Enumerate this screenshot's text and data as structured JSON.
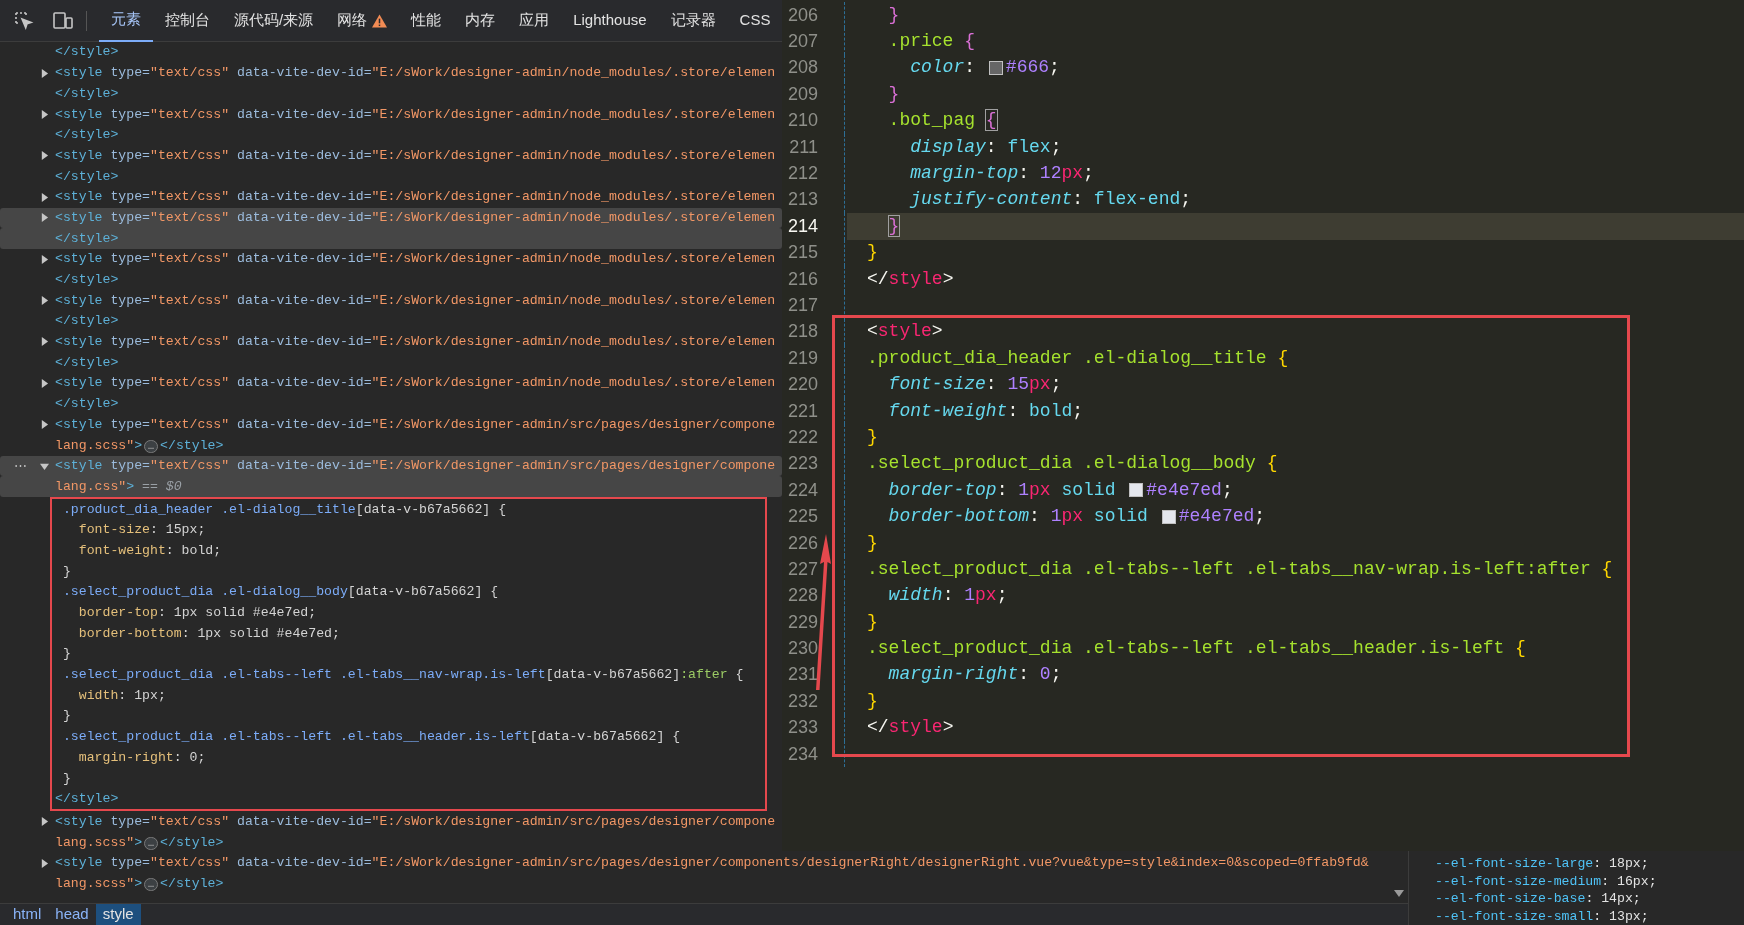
{
  "devtools": {
    "tabs": [
      {
        "label": "元素",
        "selected": true
      },
      {
        "label": "控制台",
        "selected": false
      },
      {
        "label": "源代码/来源",
        "selected": false
      },
      {
        "label": "网络",
        "selected": false,
        "warning": true
      },
      {
        "label": "性能",
        "selected": false
      },
      {
        "label": "内存",
        "selected": false
      },
      {
        "label": "应用",
        "selected": false
      },
      {
        "label": "Lighthouse",
        "selected": false
      },
      {
        "label": "记录器",
        "selected": false
      },
      {
        "label": "CSS",
        "selected": false
      }
    ],
    "rows": [
      {
        "kind": "node",
        "highlighted": false,
        "tokens": [
          {
            "kind": "tag",
            "text": "</style>"
          }
        ]
      },
      {
        "kind": "node",
        "highlighted": false,
        "expanded": false,
        "tokens": [
          {
            "kind": "tag",
            "text": "<style"
          },
          {
            "kind": "attr",
            "text": " type="
          },
          {
            "kind": "val",
            "text": "\"text/css\""
          },
          {
            "kind": "attr",
            "text": " data-vite-dev-id="
          },
          {
            "kind": "val",
            "text": "\"E:/sWork/designer-admin/node_modules/.store/elemen"
          }
        ]
      },
      {
        "kind": "node",
        "highlighted": false,
        "tokens": [
          {
            "kind": "tag",
            "text": "</style>"
          }
        ]
      },
      {
        "kind": "node",
        "highlighted": false,
        "expanded": false,
        "tokens": [
          {
            "kind": "tag",
            "text": "<style"
          },
          {
            "kind": "attr",
            "text": " type="
          },
          {
            "kind": "val",
            "text": "\"text/css\""
          },
          {
            "kind": "attr",
            "text": " data-vite-dev-id="
          },
          {
            "kind": "val",
            "text": "\"E:/sWork/designer-admin/node_modules/.store/elemen"
          }
        ]
      },
      {
        "kind": "node",
        "highlighted": false,
        "tokens": [
          {
            "kind": "tag",
            "text": "</style>"
          }
        ]
      },
      {
        "kind": "node",
        "highlighted": false,
        "expanded": false,
        "tokens": [
          {
            "kind": "tag",
            "text": "<style"
          },
          {
            "kind": "attr",
            "text": " type="
          },
          {
            "kind": "val",
            "text": "\"text/css\""
          },
          {
            "kind": "attr",
            "text": " data-vite-dev-id="
          },
          {
            "kind": "val",
            "text": "\"E:/sWork/designer-admin/node_modules/.store/elemen"
          }
        ]
      },
      {
        "kind": "node",
        "highlighted": false,
        "tokens": [
          {
            "kind": "tag",
            "text": "</style>"
          }
        ]
      },
      {
        "kind": "node",
        "highlighted": false,
        "expanded": false,
        "tokens": [
          {
            "kind": "tag",
            "text": "<style"
          },
          {
            "kind": "attr",
            "text": " type="
          },
          {
            "kind": "val",
            "text": "\"text/css\""
          },
          {
            "kind": "attr",
            "text": " data-vite-dev-id="
          },
          {
            "kind": "val",
            "text": "\"E:/sWork/designer-admin/node_modules/.store/elemen"
          }
        ]
      },
      {
        "kind": "node",
        "highlighted": true,
        "expanded": false,
        "tokens": [
          {
            "kind": "tag",
            "text": "<style"
          },
          {
            "kind": "attr",
            "text": " type="
          },
          {
            "kind": "val",
            "text": "\"text/css\""
          },
          {
            "kind": "attr",
            "text": " data-vite-dev-id="
          },
          {
            "kind": "val",
            "text": "\"E:/sWork/designer-admin/node_modules/.store/elemen"
          }
        ]
      },
      {
        "kind": "node",
        "highlighted": true,
        "tokens": [
          {
            "kind": "tag",
            "text": "</style>"
          }
        ]
      },
      {
        "kind": "node",
        "highlighted": false,
        "expanded": false,
        "tokens": [
          {
            "kind": "tag",
            "text": "<style"
          },
          {
            "kind": "attr",
            "text": " type="
          },
          {
            "kind": "val",
            "text": "\"text/css\""
          },
          {
            "kind": "attr",
            "text": " data-vite-dev-id="
          },
          {
            "kind": "val",
            "text": "\"E:/sWork/designer-admin/node_modules/.store/elemen"
          }
        ]
      },
      {
        "kind": "node",
        "highlighted": false,
        "tokens": [
          {
            "kind": "tag",
            "text": "</style>"
          }
        ]
      },
      {
        "kind": "node",
        "highlighted": false,
        "expanded": false,
        "tokens": [
          {
            "kind": "tag",
            "text": "<style"
          },
          {
            "kind": "attr",
            "text": " type="
          },
          {
            "kind": "val",
            "text": "\"text/css\""
          },
          {
            "kind": "attr",
            "text": " data-vite-dev-id="
          },
          {
            "kind": "val",
            "text": "\"E:/sWork/designer-admin/node_modules/.store/elemen"
          }
        ]
      },
      {
        "kind": "node",
        "highlighted": false,
        "tokens": [
          {
            "kind": "tag",
            "text": "</style>"
          }
        ]
      },
      {
        "kind": "node",
        "highlighted": false,
        "expanded": false,
        "tokens": [
          {
            "kind": "tag",
            "text": "<style"
          },
          {
            "kind": "attr",
            "text": " type="
          },
          {
            "kind": "val",
            "text": "\"text/css\""
          },
          {
            "kind": "attr",
            "text": " data-vite-dev-id="
          },
          {
            "kind": "val",
            "text": "\"E:/sWork/designer-admin/node_modules/.store/elemen"
          }
        ]
      },
      {
        "kind": "node",
        "highlighted": false,
        "tokens": [
          {
            "kind": "tag",
            "text": "</style>"
          }
        ]
      },
      {
        "kind": "node",
        "highlighted": false,
        "expanded": false,
        "tokens": [
          {
            "kind": "tag",
            "text": "<style"
          },
          {
            "kind": "attr",
            "text": " type="
          },
          {
            "kind": "val",
            "text": "\"text/css\""
          },
          {
            "kind": "attr",
            "text": " data-vite-dev-id="
          },
          {
            "kind": "val",
            "text": "\"E:/sWork/designer-admin/node_modules/.store/elemen"
          }
        ]
      },
      {
        "kind": "node",
        "highlighted": false,
        "tokens": [
          {
            "kind": "tag",
            "text": "</style>"
          }
        ]
      },
      {
        "kind": "node",
        "highlighted": false,
        "expanded": false,
        "tokens": [
          {
            "kind": "tag",
            "text": "<style"
          },
          {
            "kind": "attr",
            "text": " type="
          },
          {
            "kind": "val",
            "text": "\"text/css\""
          },
          {
            "kind": "attr",
            "text": " data-vite-dev-id="
          },
          {
            "kind": "val",
            "text": "\"E:/sWork/designer-admin/src/pages/designer/compone"
          }
        ]
      },
      {
        "kind": "node",
        "highlighted": false,
        "tokens": [
          {
            "kind": "val",
            "text": "lang.scss\""
          },
          {
            "kind": "tag",
            "text": ">"
          },
          {
            "kind": "badge",
            "text": "…"
          },
          {
            "kind": "tag",
            "text": "</style>"
          }
        ]
      },
      {
        "kind": "node",
        "highlighted": true,
        "expanded": true,
        "marker": "⋯",
        "tokens": [
          {
            "kind": "tag",
            "text": "<style"
          },
          {
            "kind": "attr",
            "text": " type="
          },
          {
            "kind": "val",
            "text": "\"text/css\""
          },
          {
            "kind": "attr",
            "text": " data-vite-dev-id="
          },
          {
            "kind": "val",
            "text": "\"E:/sWork/designer-admin/src/pages/designer/compone"
          }
        ]
      },
      {
        "kind": "node",
        "highlighted": true,
        "tokens": [
          {
            "kind": "val",
            "text": "lang.css\""
          },
          {
            "kind": "tag",
            "text": ">"
          },
          {
            "kind": "note",
            "text": " == $0"
          }
        ]
      },
      {
        "kind": "annotation_frame",
        "rows": [
          {
            "tokens": [
              {
                "kind": "sel",
                "text": " .product_dia_header .el-dialog__title"
              },
              {
                "kind": "plain",
                "text": "[data-v-b67a5662] {"
              }
            ]
          },
          {
            "tokens": [
              {
                "kind": "prop",
                "text": "   font-size"
              },
              {
                "kind": "plain",
                "text": ": 15px;"
              }
            ]
          },
          {
            "tokens": [
              {
                "kind": "prop",
                "text": "   font-weight"
              },
              {
                "kind": "plain",
                "text": ": bold;"
              }
            ]
          },
          {
            "tokens": [
              {
                "kind": "plain",
                "text": " }"
              }
            ]
          },
          {
            "tokens": [
              {
                "kind": "sel",
                "text": " .select_product_dia .el-dialog__body"
              },
              {
                "kind": "plain",
                "text": "[data-v-b67a5662] {"
              }
            ]
          },
          {
            "tokens": [
              {
                "kind": "prop",
                "text": "   border-top"
              },
              {
                "kind": "plain",
                "text": ": 1px solid #e4e7ed;"
              }
            ]
          },
          {
            "tokens": [
              {
                "kind": "prop",
                "text": "   border-bottom"
              },
              {
                "kind": "plain",
                "text": ": 1px solid #e4e7ed;"
              }
            ]
          },
          {
            "tokens": [
              {
                "kind": "plain",
                "text": " }"
              }
            ]
          },
          {
            "tokens": [
              {
                "kind": "sel",
                "text": " .select_product_dia .el-tabs--left .el-tabs__nav-wrap.is-left"
              },
              {
                "kind": "plain",
                "text": "[data-v-b67a5662]"
              },
              {
                "kind": "pseudo",
                "text": ":after"
              },
              {
                "kind": "plain",
                "text": " {"
              }
            ]
          },
          {
            "tokens": [
              {
                "kind": "prop",
                "text": "   width"
              },
              {
                "kind": "plain",
                "text": ": 1px;"
              }
            ]
          },
          {
            "tokens": [
              {
                "kind": "plain",
                "text": " }"
              }
            ]
          },
          {
            "tokens": [
              {
                "kind": "sel",
                "text": " .select_product_dia .el-tabs--left .el-tabs__header.is-left"
              },
              {
                "kind": "plain",
                "text": "[data-v-b67a5662] {"
              }
            ]
          },
          {
            "tokens": [
              {
                "kind": "prop",
                "text": "   margin-right"
              },
              {
                "kind": "plain",
                "text": ": 0;"
              }
            ]
          },
          {
            "tokens": [
              {
                "kind": "plain",
                "text": " }"
              }
            ]
          },
          {
            "tokens": [
              {
                "kind": "tag",
                "text": "</style>"
              }
            ]
          }
        ]
      },
      {
        "kind": "node",
        "highlighted": false,
        "expanded": false,
        "tokens": [
          {
            "kind": "tag",
            "text": "<style"
          },
          {
            "kind": "attr",
            "text": " type="
          },
          {
            "kind": "val",
            "text": "\"text/css\""
          },
          {
            "kind": "attr",
            "text": " data-vite-dev-id="
          },
          {
            "kind": "val",
            "text": "\"E:/sWork/designer-admin/src/pages/designer/compone"
          }
        ]
      },
      {
        "kind": "node",
        "highlighted": false,
        "tokens": [
          {
            "kind": "val",
            "text": "lang.scss\""
          },
          {
            "kind": "tag",
            "text": ">"
          },
          {
            "kind": "badge",
            "text": "…"
          },
          {
            "kind": "tag",
            "text": "</style>"
          }
        ]
      },
      {
        "kind": "node",
        "highlighted": false,
        "expanded": false,
        "tokens": [
          {
            "kind": "tag",
            "text": "<style"
          },
          {
            "kind": "attr",
            "text": " type="
          },
          {
            "kind": "val",
            "text": "\"text/css\""
          },
          {
            "kind": "attr",
            "text": " data-vite-dev-id="
          },
          {
            "kind": "val",
            "text": "\"E:/sWork/designer-admin/src/pages/designer/components/designerRight/designerRight.vue?vue&type=style&index=0&scoped=0ffab9fd&"
          }
        ]
      },
      {
        "kind": "node",
        "highlighted": false,
        "tokens": [
          {
            "kind": "val",
            "text": "lang.scss\""
          },
          {
            "kind": "tag",
            "text": ">"
          },
          {
            "kind": "badge",
            "text": "…"
          },
          {
            "kind": "tag",
            "text": "</style>"
          }
        ]
      }
    ],
    "breadcrumbs": [
      {
        "label": "html",
        "selected": false
      },
      {
        "label": "head",
        "selected": false
      },
      {
        "label": "style",
        "selected": true
      }
    ],
    "styles": [
      {
        "prop": "--el-font-size-large",
        "value": ": 18px;"
      },
      {
        "prop": "--el-font-size-medium",
        "value": ": 16px;"
      },
      {
        "prop": "--el-font-size-base",
        "value": ": 14px;"
      },
      {
        "prop": "--el-font-size-small",
        "value": ": 13px;"
      }
    ]
  },
  "editor": {
    "lines": [
      {
        "number": "206",
        "current": false,
        "tokens": [
          {
            "kind": "bi",
            "text": "  }"
          }
        ]
      },
      {
        "number": "207",
        "current": false,
        "tokens": [
          {
            "kind": "sel",
            "text": "  .price "
          },
          {
            "kind": "bi",
            "text": "{"
          }
        ]
      },
      {
        "number": "208",
        "current": false,
        "tokens": [
          {
            "kind": "prop",
            "text": "    color"
          },
          {
            "kind": "p",
            "text": ": "
          },
          {
            "kind": "sw",
            "color": "#666666"
          },
          {
            "kind": "hex",
            "text": "#666"
          },
          {
            "kind": "p",
            "text": ";"
          }
        ]
      },
      {
        "number": "209",
        "current": false,
        "tokens": [
          {
            "kind": "bi",
            "text": "  }"
          }
        ]
      },
      {
        "number": "210",
        "current": false,
        "tokens": [
          {
            "kind": "sel",
            "text": "  .bot_pag "
          },
          {
            "kind": "bi",
            "text": "{",
            "matched": true
          }
        ]
      },
      {
        "number": "211",
        "current": false,
        "tokens": [
          {
            "kind": "prop",
            "text": "    display"
          },
          {
            "kind": "p",
            "text": ": "
          },
          {
            "kind": "v",
            "text": "flex"
          },
          {
            "kind": "p",
            "text": ";"
          }
        ]
      },
      {
        "number": "212",
        "current": false,
        "tokens": [
          {
            "kind": "prop",
            "text": "    margin-top"
          },
          {
            "kind": "p",
            "text": ": "
          },
          {
            "kind": "n",
            "text": "12"
          },
          {
            "kind": "u",
            "text": "px"
          },
          {
            "kind": "p",
            "text": ";"
          }
        ]
      },
      {
        "number": "213",
        "current": false,
        "tokens": [
          {
            "kind": "prop",
            "text": "    justify-content"
          },
          {
            "kind": "p",
            "text": ": "
          },
          {
            "kind": "v",
            "text": "flex-end"
          },
          {
            "kind": "p",
            "text": ";"
          }
        ]
      },
      {
        "number": "214",
        "current": true,
        "tokens": [
          {
            "kind": "bi",
            "text": "  }",
            "matched": true
          }
        ]
      },
      {
        "number": "215",
        "current": false,
        "tokens": [
          {
            "kind": "bo",
            "text": "}"
          }
        ]
      },
      {
        "number": "216",
        "current": false,
        "tokens": [
          {
            "kind": "p",
            "text": "</"
          },
          {
            "kind": "tag",
            "text": "style"
          },
          {
            "kind": "p",
            "text": ">"
          }
        ]
      },
      {
        "number": "217",
        "current": false
      },
      {
        "number": "218",
        "current": false,
        "tokens": [
          {
            "kind": "p",
            "text": "<"
          },
          {
            "kind": "tag",
            "text": "style"
          },
          {
            "kind": "p",
            "text": ">"
          }
        ]
      },
      {
        "number": "219",
        "current": false,
        "tokens": [
          {
            "kind": "sel",
            "text": ".product_dia_header .el-dialog__title "
          },
          {
            "kind": "bo",
            "text": "{"
          }
        ]
      },
      {
        "number": "220",
        "current": false,
        "tokens": [
          {
            "kind": "prop",
            "text": "  font-size"
          },
          {
            "kind": "p",
            "text": ": "
          },
          {
            "kind": "n",
            "text": "15"
          },
          {
            "kind": "u",
            "text": "px"
          },
          {
            "kind": "p",
            "text": ";"
          }
        ]
      },
      {
        "number": "221",
        "current": false,
        "tokens": [
          {
            "kind": "prop",
            "text": "  font-weight"
          },
          {
            "kind": "p",
            "text": ": "
          },
          {
            "kind": "v",
            "text": "bold"
          },
          {
            "kind": "p",
            "text": ";"
          }
        ]
      },
      {
        "number": "222",
        "current": false,
        "tokens": [
          {
            "kind": "bo",
            "text": "}"
          }
        ]
      },
      {
        "number": "223",
        "current": false,
        "tokens": [
          {
            "kind": "sel",
            "text": ".select_product_dia .el-dialog__body "
          },
          {
            "kind": "bo",
            "text": "{"
          }
        ]
      },
      {
        "number": "224",
        "current": false,
        "tokens": [
          {
            "kind": "prop",
            "text": "  border-top"
          },
          {
            "kind": "p",
            "text": ": "
          },
          {
            "kind": "n",
            "text": "1"
          },
          {
            "kind": "u",
            "text": "px"
          },
          {
            "kind": "v",
            "text": " solid "
          },
          {
            "kind": "sw",
            "color": "#e4e7ed"
          },
          {
            "kind": "hex",
            "text": "#e4e7ed"
          },
          {
            "kind": "p",
            "text": ";"
          }
        ]
      },
      {
        "number": "225",
        "current": false,
        "tokens": [
          {
            "kind": "prop",
            "text": "  border-bottom"
          },
          {
            "kind": "p",
            "text": ": "
          },
          {
            "kind": "n",
            "text": "1"
          },
          {
            "kind": "u",
            "text": "px"
          },
          {
            "kind": "v",
            "text": " solid "
          },
          {
            "kind": "sw",
            "color": "#e4e7ed"
          },
          {
            "kind": "hex",
            "text": "#e4e7ed"
          },
          {
            "kind": "p",
            "text": ";"
          }
        ]
      },
      {
        "number": "226",
        "current": false,
        "tokens": [
          {
            "kind": "bo",
            "text": "}"
          }
        ]
      },
      {
        "number": "227",
        "current": false,
        "tokens": [
          {
            "kind": "sel",
            "text": ".select_product_dia .el-tabs--left .el-tabs__nav-wrap.is-left:after "
          },
          {
            "kind": "bo",
            "text": "{"
          }
        ]
      },
      {
        "number": "228",
        "current": false,
        "tokens": [
          {
            "kind": "prop",
            "text": "  width"
          },
          {
            "kind": "p",
            "text": ": "
          },
          {
            "kind": "n",
            "text": "1"
          },
          {
            "kind": "u",
            "text": "px"
          },
          {
            "kind": "p",
            "text": ";"
          }
        ]
      },
      {
        "number": "229",
        "current": false,
        "tokens": [
          {
            "kind": "bo",
            "text": "}"
          }
        ]
      },
      {
        "number": "230",
        "current": false,
        "tokens": [
          {
            "kind": "sel",
            "text": ".select_product_dia .el-tabs--left .el-tabs__header.is-left "
          },
          {
            "kind": "bo",
            "text": "{"
          }
        ]
      },
      {
        "number": "231",
        "current": false,
        "tokens": [
          {
            "kind": "prop",
            "text": "  margin-right"
          },
          {
            "kind": "p",
            "text": ": "
          },
          {
            "kind": "n",
            "text": "0"
          },
          {
            "kind": "p",
            "text": ";"
          }
        ]
      },
      {
        "number": "232",
        "current": false,
        "tokens": [
          {
            "kind": "bo",
            "text": "}"
          }
        ]
      },
      {
        "number": "233",
        "current": false,
        "tokens": [
          {
            "kind": "p",
            "text": "</"
          },
          {
            "kind": "tag",
            "text": "style"
          },
          {
            "kind": "p",
            "text": ">"
          }
        ]
      },
      {
        "number": "234",
        "current": false
      }
    ]
  }
}
